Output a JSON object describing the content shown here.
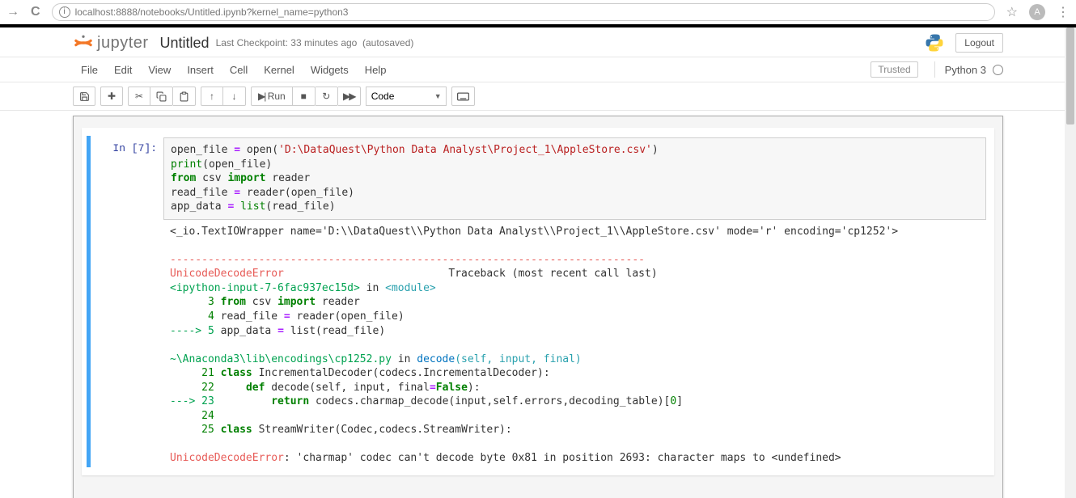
{
  "browser": {
    "url": "localhost:8888/notebooks/Untitled.ipynb?kernel_name=python3",
    "avatar_letter": "A"
  },
  "header": {
    "logo_text": "jupyter",
    "notebook_name": "Untitled",
    "checkpoint": "Last Checkpoint: 33 minutes ago",
    "autosave": "(autosaved)",
    "logout": "Logout"
  },
  "menubar": {
    "items": [
      "File",
      "Edit",
      "View",
      "Insert",
      "Cell",
      "Kernel",
      "Widgets",
      "Help"
    ],
    "trusted": "Trusted",
    "kernel": "Python 3"
  },
  "toolbar": {
    "save_icon": "save-icon",
    "add_icon": "plus-icon",
    "cut_icon": "cut-icon",
    "copy_icon": "copy-icon",
    "paste_icon": "paste-icon",
    "up_icon": "arrow-up-icon",
    "down_icon": "arrow-down-icon",
    "run_label": "Run",
    "stop_icon": "stop-icon",
    "restart_icon": "restart-icon",
    "ff_icon": "fast-forward-icon",
    "select_value": "Code",
    "cmd_icon": "keyboard-icon"
  },
  "cell": {
    "prompt": "In [7]:",
    "code": {
      "l1a": "open_file ",
      "l1b": "=",
      "l1c": " open(",
      "l1d": "'D:\\DataQuest\\Python Data Analyst\\Project_1\\AppleStore.csv'",
      "l1e": ")",
      "l2a": "print",
      "l2b": "(open_file)",
      "l3a": "from",
      "l3b": " csv ",
      "l3c": "import",
      "l3d": " reader",
      "l4a": "read_file ",
      "l4b": "=",
      "l4c": " reader(open_file)",
      "l5a": "app_data ",
      "l5b": "=",
      "l5c": " ",
      "l5d": "list",
      "l5e": "(read_file)"
    },
    "output": {
      "repr": "<_io.TextIOWrapper name='D:\\\\DataQuest\\\\Python Data Analyst\\\\Project_1\\\\AppleStore.csv' mode='r' encoding='cp1252'>",
      "sep": "---------------------------------------------------------------------------",
      "err_name": "UnicodeDecodeError",
      "err_tb": "                          Traceback (most recent call last)",
      "loc1a": "<ipython-input-7-6fac937ec15d>",
      "loc1b": " in ",
      "loc1c": "<module>",
      "tl3": "      3 from csv import reader",
      "tl3_pre": "      3 ",
      "tl3_from": "from",
      "tl3_csv": " csv ",
      "tl3_import": "import",
      "tl3_reader": " reader",
      "tl4_pre": "      4 ",
      "tl4_rest": "read_file ",
      "tl4_eq": "=",
      "tl4_call": " reader",
      "tl4_par": "(",
      "tl4_arg": "open_file",
      "tl4_cp": ")",
      "tl5_arrow": "----> 5 ",
      "tl5_rest": "app_data ",
      "tl5_eq": "=",
      "tl5_list": " list",
      "tl5_par": "(",
      "tl5_arg": "read_file",
      "tl5_cp": ")",
      "loc2a": "~\\Anaconda3\\lib\\encodings\\cp1252.py",
      "loc2b": " in ",
      "loc2c": "decode",
      "loc2d": "(self, input, final)",
      "f21_pre": "     21 ",
      "f21_class": "class",
      "f21_rest": " IncrementalDecoder",
      "f21_par": "(",
      "f21_arg": "codecs",
      "f21_dot": ".",
      "f21_arg2": "IncrementalDecoder",
      "f21_cp": "):",
      "f22_pre": "     22     ",
      "f22_def": "def",
      "f22_name": " decode",
      "f22_par": "(",
      "f22_self": "self",
      "f22_c1": ",",
      "f22_inp": " input",
      "f22_c2": ",",
      "f22_fin": " final",
      "f22_eq": "=",
      "f22_false": "False",
      "f22_cp": "):",
      "f23_arrow": "---> 23         ",
      "f23_return": "return",
      "f23_rest": " codecs",
      "f23_dot": ".",
      "f23_cm": "charmap_decode",
      "f23_par": "(",
      "f23_args": "input",
      "f23_c": ",",
      "f23_self": "self",
      "f23_d2": ".",
      "f23_err": "errors",
      "f23_c2": ",",
      "f23_dt": "decoding_table",
      "f23_cp": ")[",
      "f23_zero": "0",
      "f23_cb": "]",
      "f24": "     24 ",
      "f25_pre": "     25 ",
      "f25_class": "class",
      "f25_name": " StreamWriter",
      "f25_par": "(",
      "f25_a1": "Codec",
      "f25_c": ",",
      "f25_a2": "codecs",
      "f25_d": ".",
      "f25_a3": "StreamWriter",
      "f25_cp": "):",
      "final_err": "UnicodeDecodeError",
      "final_msg": ": 'charmap' codec can't decode byte 0x81 in position 2693: character maps to <undefined>"
    }
  }
}
